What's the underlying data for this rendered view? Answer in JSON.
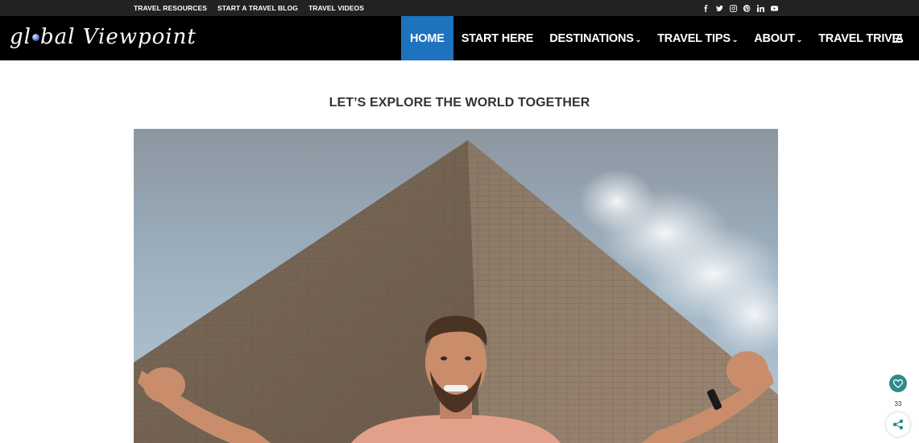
{
  "top_bar": {
    "links": [
      "TRAVEL RESOURCES",
      "START A TRAVEL BLOG",
      "TRAVEL VIDEOS"
    ],
    "social_icons": [
      "facebook-icon",
      "twitter-icon",
      "instagram-icon",
      "pinterest-icon",
      "linkedin-icon",
      "youtube-icon"
    ]
  },
  "header": {
    "logo_part1": "gl",
    "logo_part2": "bal Viewpoint",
    "nav": [
      {
        "label": "HOME",
        "active": true,
        "dropdown": false
      },
      {
        "label": "START HERE",
        "active": false,
        "dropdown": false
      },
      {
        "label": "DESTINATIONS",
        "active": false,
        "dropdown": true
      },
      {
        "label": "TRAVEL TIPS",
        "active": false,
        "dropdown": true
      },
      {
        "label": "ABOUT",
        "active": false,
        "dropdown": true
      },
      {
        "label": "TRAVEL TRIVIA",
        "active": false,
        "dropdown": false
      }
    ],
    "chevron_glyph": "⌄",
    "menu_icon": "hamburger-icon"
  },
  "main": {
    "tagline": "LET’S EXPLORE THE WORLD TOGETHER",
    "hero_image": "man-at-pyramid-photo"
  },
  "floating": {
    "heart_icon": "heart-icon",
    "count": "33",
    "share_icon": "share-icon"
  },
  "colors": {
    "accent": "#1e73be",
    "top_bar": "#222222",
    "nav_bar": "#000000",
    "float_button": "#2e8b8a"
  }
}
